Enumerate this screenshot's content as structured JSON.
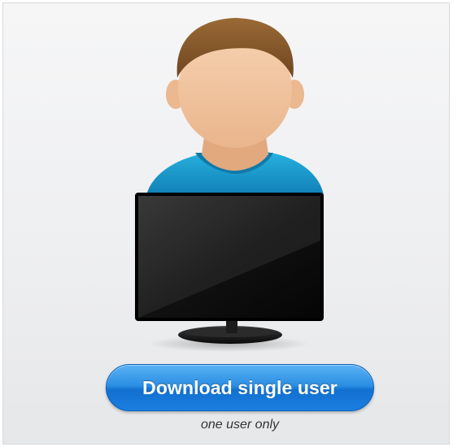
{
  "download_card": {
    "illustration": {
      "person_icon": "user-avatar-icon",
      "monitor_icon": "desktop-monitor-icon",
      "colors": {
        "hair": "#8a5a2b",
        "skin": "#f2c39c",
        "shirt": "#1a9fd1",
        "screen": "#0d0d0d"
      }
    },
    "button": {
      "label": "Download single user",
      "color": "#2c8fe3"
    },
    "caption": "one user only"
  }
}
